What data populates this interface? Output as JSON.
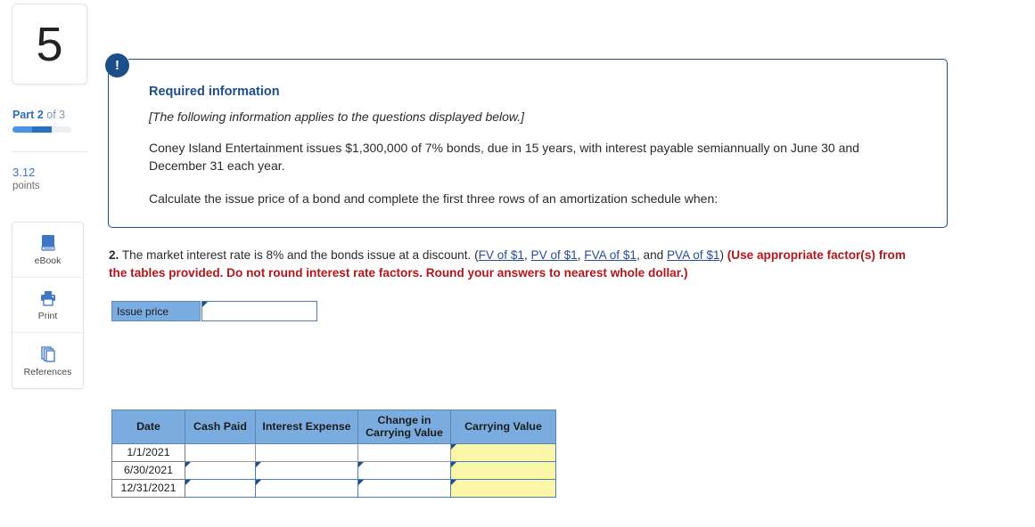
{
  "sidebar": {
    "question_number": "5",
    "part": {
      "prefix": "Part",
      "current": "2",
      "of": "of 3"
    },
    "progress": {
      "segments": 2,
      "total": 3
    },
    "points": {
      "value": "3.12",
      "label": "points"
    },
    "tools": [
      {
        "id": "ebook",
        "label": "eBook",
        "icon": "book-icon"
      },
      {
        "id": "print",
        "label": "Print",
        "icon": "printer-icon"
      },
      {
        "id": "references",
        "label": "References",
        "icon": "copy-pages-icon"
      }
    ]
  },
  "info_box": {
    "badge_icon": "exclamation-icon",
    "title": "Required information",
    "italic_note": "[The following information applies to the questions displayed below.]",
    "paragraph1": "Coney Island Entertainment issues $1,300,000 of 7% bonds, due in 15 years, with interest payable semiannually on June 30 and December 31 each year.",
    "paragraph2": "Calculate the issue price of a bond and complete the first three rows of an amortization schedule when:"
  },
  "question": {
    "number": "2.",
    "text_before_links": " The market interest rate is 8% and the bonds issue at a discount. (",
    "links": [
      {
        "label": "FV of $1",
        "sep": ", "
      },
      {
        "label": "PV of $1",
        "sep": ", "
      },
      {
        "label": "FVA of $1",
        "sep": ", and "
      },
      {
        "label": "PVA of $1",
        "sep": ")"
      }
    ],
    "instruction_bold_red": " (Use appropriate factor(s) from the tables provided. Do not round interest rate factors. Round your answers to nearest whole dollar.)"
  },
  "issue_price": {
    "label": "Issue price",
    "value": "",
    "placeholder": ""
  },
  "amortization_table": {
    "columns": [
      "Date",
      "Cash Paid",
      "Interest Expense",
      "Change in Carrying Value",
      "Carrying  Value"
    ],
    "column_lines": [
      [
        "Date"
      ],
      [
        "Cash Paid"
      ],
      [
        "Interest Expense"
      ],
      [
        "Change in",
        "Carrying Value"
      ],
      [
        "Carrying  Value"
      ]
    ],
    "rows": [
      {
        "date": "1/1/2021",
        "cash_paid": {
          "value": "",
          "editable": false
        },
        "interest_expense": {
          "value": "",
          "editable": false
        },
        "change_in_carrying_value": {
          "value": "",
          "editable": false
        },
        "carrying_value": {
          "value": "",
          "editable": true
        }
      },
      {
        "date": "6/30/2021",
        "cash_paid": {
          "value": "",
          "editable": true
        },
        "interest_expense": {
          "value": "",
          "editable": true
        },
        "change_in_carrying_value": {
          "value": "",
          "editable": true
        },
        "carrying_value": {
          "value": "",
          "editable": true
        }
      },
      {
        "date": "12/31/2021",
        "cash_paid": {
          "value": "",
          "editable": true
        },
        "interest_expense": {
          "value": "",
          "editable": true
        },
        "change_in_carrying_value": {
          "value": "",
          "editable": true
        },
        "carrying_value": {
          "value": "",
          "editable": true
        }
      }
    ]
  },
  "colors": {
    "header_blue": "#7aacdf",
    "accent_navy": "#1c4e8a",
    "link_blue": "#2a4d9e",
    "red_bold": "#b4161b",
    "yellow_cell": "#fcf7a8",
    "progress_light": "#4a91e2",
    "progress_dark": "#2a70c2"
  }
}
